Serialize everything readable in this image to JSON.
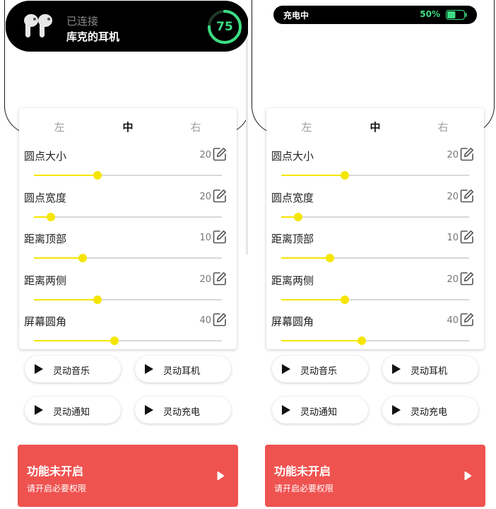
{
  "headphone": {
    "status": "已连接",
    "name": "库克的耳机",
    "battery": 75,
    "battery_color": "#3ddc84",
    "icon": "airpods-icon"
  },
  "charging": {
    "label": "充电中",
    "percent": "50%",
    "level": 0.5,
    "color": "#3ddc84"
  },
  "tabs": [
    "左",
    "中",
    "右"
  ],
  "active_tab": "中",
  "settings": [
    {
      "label": "圆点大小",
      "value": "20",
      "level": 0.34
    },
    {
      "label": "圆点宽度",
      "value": "20",
      "level": 0.09
    },
    {
      "label": "距离顶部",
      "value": "10",
      "level": 0.26
    },
    {
      "label": "距离两侧",
      "value": "20",
      "level": 0.34
    },
    {
      "label": "屏幕圆角",
      "value": "40",
      "level": 0.43
    }
  ],
  "slider_color": "#f5e600",
  "features": [
    "灵动音乐",
    "灵动耳机",
    "灵动通知",
    "灵动充电"
  ],
  "warning": {
    "title": "功能未开启",
    "subtitle": "请开启必要权限",
    "color": "#ef5350"
  }
}
